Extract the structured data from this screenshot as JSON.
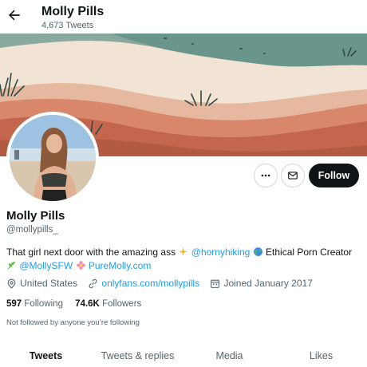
{
  "header": {
    "back_icon": "arrow-left-icon",
    "title": "Molly Pills",
    "tweet_count": "4,673 Tweets"
  },
  "profile": {
    "name": "Molly Pills",
    "handle": "@mollypills_",
    "bio": {
      "text1": "That girl next door with the amazing ass ",
      "mention1": "@hornyhiking",
      "text2": " Ethical Porn Creator",
      "mention2": "@MollySFW",
      "link": "PureMolly.com"
    },
    "location": "United States",
    "website": "onlyfans.com/mollypills",
    "joined": "Joined January 2017",
    "following_count": "597",
    "following_label": "Following",
    "followers_count": "74.6K",
    "followers_label": "Followers",
    "not_followed_text": "Not followed by anyone you’re following"
  },
  "actions": {
    "more_icon": "more-dots-icon",
    "message_icon": "envelope-icon",
    "follow_label": "Follow"
  },
  "tabs": [
    {
      "label": "Tweets",
      "active": true
    },
    {
      "label": "Tweets & replies",
      "active": false
    },
    {
      "label": "Media",
      "active": false
    },
    {
      "label": "Likes",
      "active": false
    }
  ],
  "colors": {
    "accent": "#1d9bf0",
    "text_primary": "#0f1419",
    "text_secondary": "#536471",
    "banner_sky": "#f0e2d3",
    "banner_teal": "#6f9a8e",
    "banner_terracotta": "#c56f55"
  }
}
